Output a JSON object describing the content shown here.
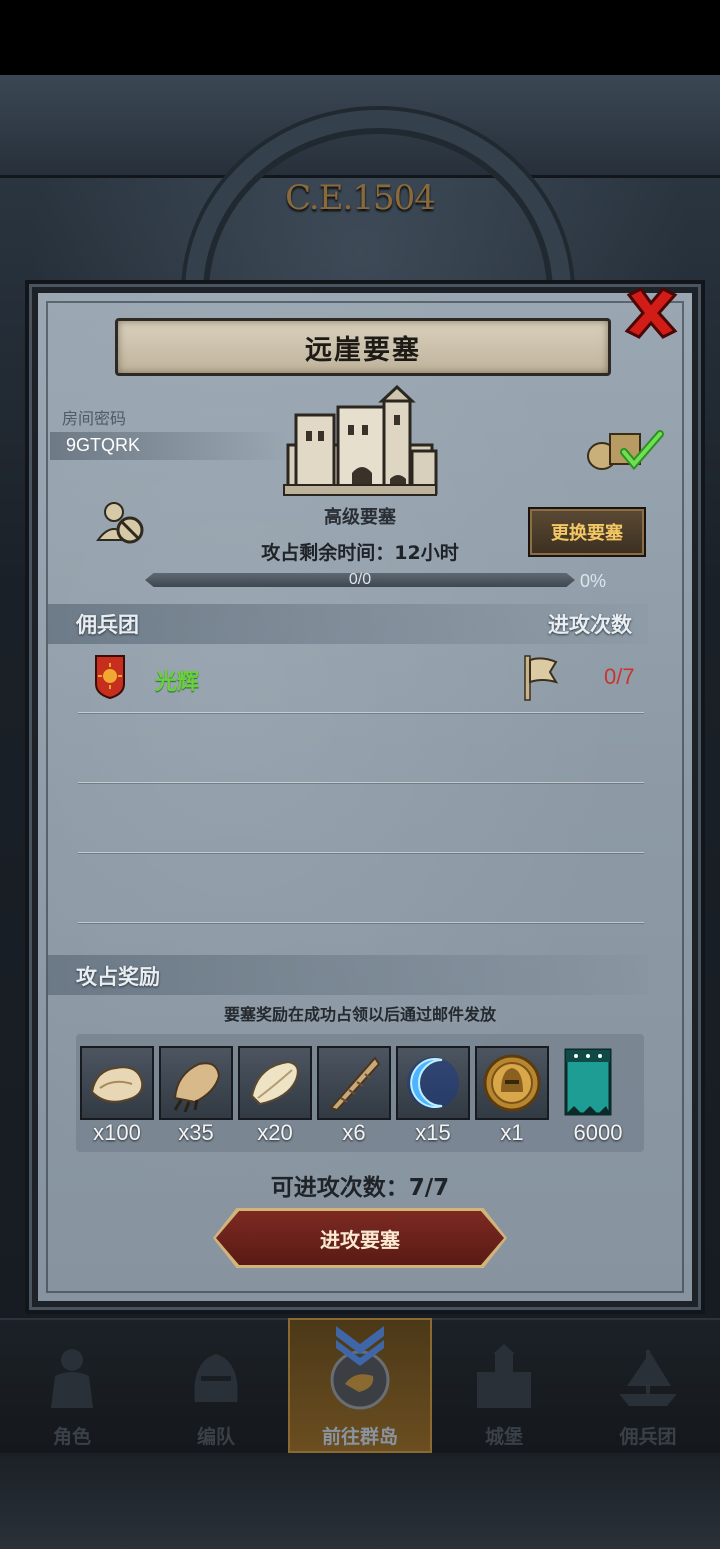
{
  "header": {
    "year": "C.E.1504"
  },
  "dialog": {
    "title": "远崖要塞",
    "room_label": "房间密码",
    "room_code": "9GTQRK",
    "fortress_type": "高级要塞",
    "time_left": "攻占剩余时间：12小时",
    "change_button": "更换要塞",
    "progress": {
      "text": "0/0",
      "percent_label": "0%",
      "fraction": 0
    },
    "mercenary_header": "佣兵团",
    "attack_count_header": "进攻次数",
    "guilds": [
      {
        "name": "光辉",
        "attacks": "0/7",
        "name_color": "#6ccf3c",
        "attacks_color": "#c8352e"
      }
    ],
    "rewards_header": "攻占奖励",
    "rewards_note": "要塞奖励在成功占领以后通过邮件发放",
    "rewards": [
      {
        "icon": "fur-pelt-icon",
        "qty": "x100"
      },
      {
        "icon": "beast-claw-icon",
        "qty": "x35"
      },
      {
        "icon": "wing-feather-icon",
        "qty": "x20"
      },
      {
        "icon": "spiral-horn-icon",
        "qty": "x6"
      },
      {
        "icon": "blue-moon-crystal-icon",
        "qty": "x15"
      },
      {
        "icon": "gold-knight-medal-icon",
        "qty": "x1"
      },
      {
        "icon": "guild-banner-token-icon",
        "qty": "6000"
      }
    ],
    "attacks_available": "可进攻次数：7/7",
    "attack_button": "进攻要塞"
  },
  "bottom_nav": [
    {
      "label": "角色",
      "icon": "knight-character-icon",
      "active": false
    },
    {
      "label": "编队",
      "icon": "helmet-team-icon",
      "active": false
    },
    {
      "label": "前往群岛",
      "icon": "island-compass-icon",
      "active": true
    },
    {
      "label": "城堡",
      "icon": "castle-icon",
      "active": false
    },
    {
      "label": "佣兵团",
      "icon": "ship-guild-icon",
      "active": false
    }
  ]
}
